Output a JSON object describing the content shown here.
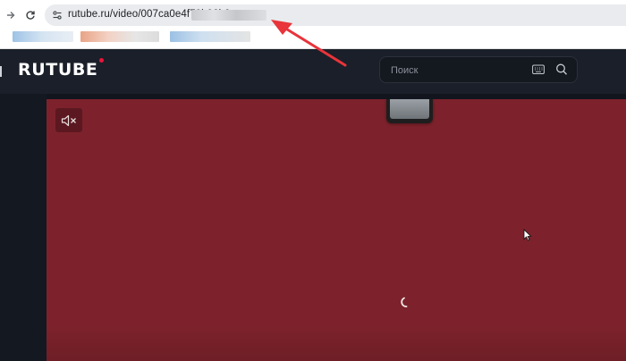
{
  "browser": {
    "back_icon": "arrow-right-icon",
    "reload_icon": "reload-icon",
    "site_info_icon": "tune-icon",
    "url_visible": "rutube.ru/video/007ca0e4f70b92b9",
    "bookmarks": [
      {
        "color": "#b9d4ec"
      },
      {
        "color": "#f0c8b8"
      },
      {
        "color": "#bcd6ee"
      }
    ]
  },
  "rutube": {
    "logo": "RUTUBE",
    "brand_color": "#ed143b",
    "search": {
      "placeholder": "Поиск"
    },
    "player": {
      "background_color": "#7d222c",
      "mute_icon": "speaker-muted-icon"
    }
  },
  "annotation": {
    "arrow_color": "#e8343a"
  }
}
